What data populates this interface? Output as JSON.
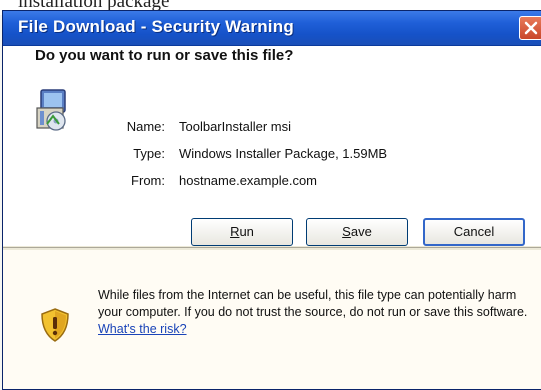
{
  "caption_fragment": "installation package",
  "window": {
    "title": "File Download - Security Warning"
  },
  "dialog": {
    "question": "Do you want to run or save this file?",
    "file_icon": "installer-package-icon",
    "fields": [
      {
        "label": "Name:",
        "value": "ToolbarInstaller msi"
      },
      {
        "label": "Type:",
        "value": "Windows Installer Package, 1.59MB"
      },
      {
        "label": "From:",
        "value": "hostname.example.com"
      }
    ],
    "buttons": {
      "run": {
        "mnemonic": "R",
        "rest": "un"
      },
      "save": {
        "mnemonic": "S",
        "rest": "ave"
      },
      "cancel": "Cancel"
    }
  },
  "warning": {
    "icon": "shield-warning-icon",
    "text": "While files from the Internet can be useful, this file type can potentially harm your computer. If you do not trust the source, do not run or save this software.",
    "link": "What's the risk?"
  },
  "colors": {
    "titlebar": "#1f5fd8",
    "dialog_bg": "#ece9d8",
    "link": "#1a44b8",
    "close_button": "#c9462a"
  }
}
